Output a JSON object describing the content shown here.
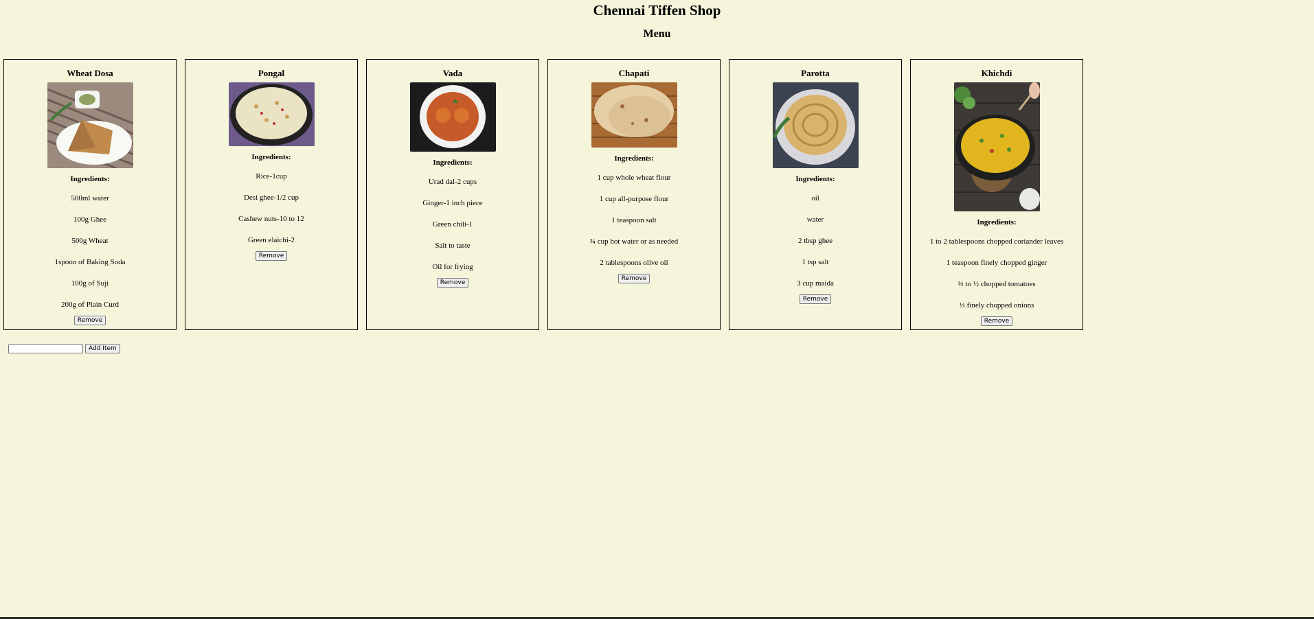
{
  "header": {
    "title": "Chennai Tiffen Shop",
    "subtitle": "Menu"
  },
  "ingredients_label": "Ingredients:",
  "remove_label": "Remove",
  "items": [
    {
      "name": "Wheat Dosa",
      "ingredients": [
        "500ml water",
        "100g Ghee",
        "500g Wheat",
        "1spoon of Baking Soda",
        "100g of Suji",
        "200g of Plain Curd"
      ]
    },
    {
      "name": "Pongal",
      "ingredients": [
        "Rice-1cup",
        "Desi ghee-1/2 cup",
        "Cashew nuts-10 to 12",
        "Green elaichi-2"
      ]
    },
    {
      "name": "Vada",
      "ingredients": [
        "Urad dal-2 cups",
        "Ginger-1 inch piece",
        "Green chili-1",
        "Salt to taste",
        "Oil for frying"
      ]
    },
    {
      "name": "Chapati",
      "ingredients": [
        "1 cup whole wheat flour",
        "1 cup all-purpose flour",
        "1 teaspoon salt",
        "¾ cup hot water or as needed",
        "2 tablespoons olive oil"
      ]
    },
    {
      "name": "Parotta",
      "ingredients": [
        "oil",
        "water",
        "2 tbsp ghee",
        "1 tsp salt",
        "3 cup maida"
      ]
    },
    {
      "name": "Khichdi",
      "ingredients": [
        "1 to 2 tablespoons chopped coriander leaves",
        "1 teaspoon finely chopped ginger",
        "⅓ to ½ chopped tomatoes",
        "⅓ finely chopped onions"
      ]
    }
  ],
  "add_form": {
    "input_value": "",
    "button_label": "Add Item"
  }
}
